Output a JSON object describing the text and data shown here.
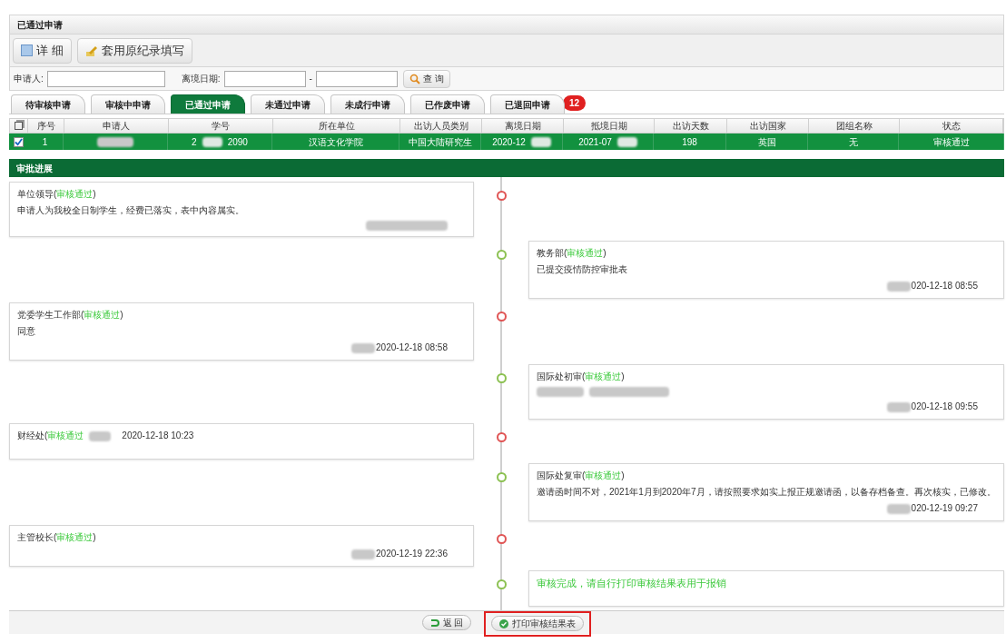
{
  "title": "已通过申请",
  "toolbar": [
    {
      "label": "详 细",
      "kind": "detail"
    },
    {
      "label": "套用原纪录填写",
      "kind": "copy"
    }
  ],
  "filters": {
    "applicant_label": "申请人:",
    "date_label": "离境日期:",
    "date_separator": "-",
    "search_button": "查 询"
  },
  "tabs": [
    {
      "label": "待审核申请",
      "selected": false
    },
    {
      "label": "审核中申请",
      "selected": false
    },
    {
      "label": "已通过申请",
      "selected": true
    },
    {
      "label": "未通过申请",
      "selected": false
    },
    {
      "label": "未成行申请",
      "selected": false
    },
    {
      "label": "已作废申请",
      "selected": false
    },
    {
      "label": "已退回申请",
      "selected": false,
      "badge": "12"
    }
  ],
  "table": {
    "columns": [
      "序号",
      "申请人",
      "学号",
      "所在单位",
      "出访人员类别",
      "离境日期",
      "抵境日期",
      "出访天数",
      "出访国家",
      "团组名称",
      "状态"
    ],
    "rows": [
      {
        "selected": true,
        "checked": true,
        "cells": [
          {
            "parts": [
              "1"
            ],
            "redacted": false
          },
          {
            "redacted": true
          },
          {
            "parts": [
              "2",
              "2090"
            ],
            "redacted": true
          },
          {
            "parts": [
              "汉语文化学院"
            ],
            "redacted": false
          },
          {
            "parts": [
              "中国大陆研究生"
            ],
            "redacted": false
          },
          {
            "parts": [
              "2020-12"
            ],
            "redacted": true
          },
          {
            "parts": [
              "2021-07"
            ],
            "redacted": true
          },
          {
            "parts": [
              "198"
            ],
            "redacted": false
          },
          {
            "parts": [
              "英国"
            ],
            "redacted": false
          },
          {
            "parts": [
              "无"
            ],
            "redacted": false
          },
          {
            "parts": [
              "审核通过"
            ],
            "redacted": false
          }
        ]
      }
    ]
  },
  "progress": {
    "title": "审批进展",
    "entries": [
      {
        "kind": "note",
        "right": false,
        "color": "#e05555",
        "dept": "单位领导(",
        "status": "审核通过",
        "close": ")",
        "comment": "申请人为我校全日制学生，经费已落实，表中内容属实。",
        "signer_redacted": true
      },
      {
        "kind": "note",
        "right": true,
        "color": "#8cc152",
        "dept": "教务部(",
        "status": "审核通过",
        "close": ")",
        "comment": "已提交疫情防控审批表",
        "signer_redacted": true,
        "time": "020-12-18 08:55"
      },
      {
        "kind": "note",
        "right": false,
        "color": "#e05555",
        "dept": "党委学生工作部(",
        "status": "审核通过",
        "close": ")",
        "comment": "同意",
        "signer_redacted": true,
        "time": "2020-12-18 08:58"
      },
      {
        "kind": "note",
        "right": true,
        "color": "#8cc152",
        "dept": "国际处初审(",
        "status": "审核通过",
        "close": ")",
        "comment_redacted": true,
        "signer_redacted": true,
        "time": "020-12-18 09:55"
      },
      {
        "kind": "inline",
        "right": false,
        "color": "#e05555",
        "dept": "财经处(",
        "status": "审核通过",
        "signer_redacted": true,
        "time": "2020-12-18 10:23"
      },
      {
        "kind": "note",
        "right": true,
        "color": "#8cc152",
        "dept": "国际处复审(",
        "status": "审核通过",
        "close": ")",
        "comment": "邀请函时间不对，2021年1月到2020年7月，请按照要求如实上报正规邀请函，以备存档备查。再次核实，已修改。",
        "signer_redacted": true,
        "time": "020-12-19 09:27"
      },
      {
        "kind": "note",
        "right": false,
        "color": "#e05555",
        "dept": "主管校长(",
        "status": "审核通过",
        "close": ")",
        "signer_redacted": true,
        "time": "2020-12-19 22:36"
      },
      {
        "kind": "final",
        "right": true,
        "color": "#8cc152",
        "message": "审核完成，请自行打印审核结果表用于报销"
      }
    ]
  },
  "footer_buttons": [
    {
      "label": "返 回",
      "kind": "back",
      "highlighted": false
    },
    {
      "label": "打印审核结果表",
      "kind": "print",
      "highlighted": true
    }
  ]
}
